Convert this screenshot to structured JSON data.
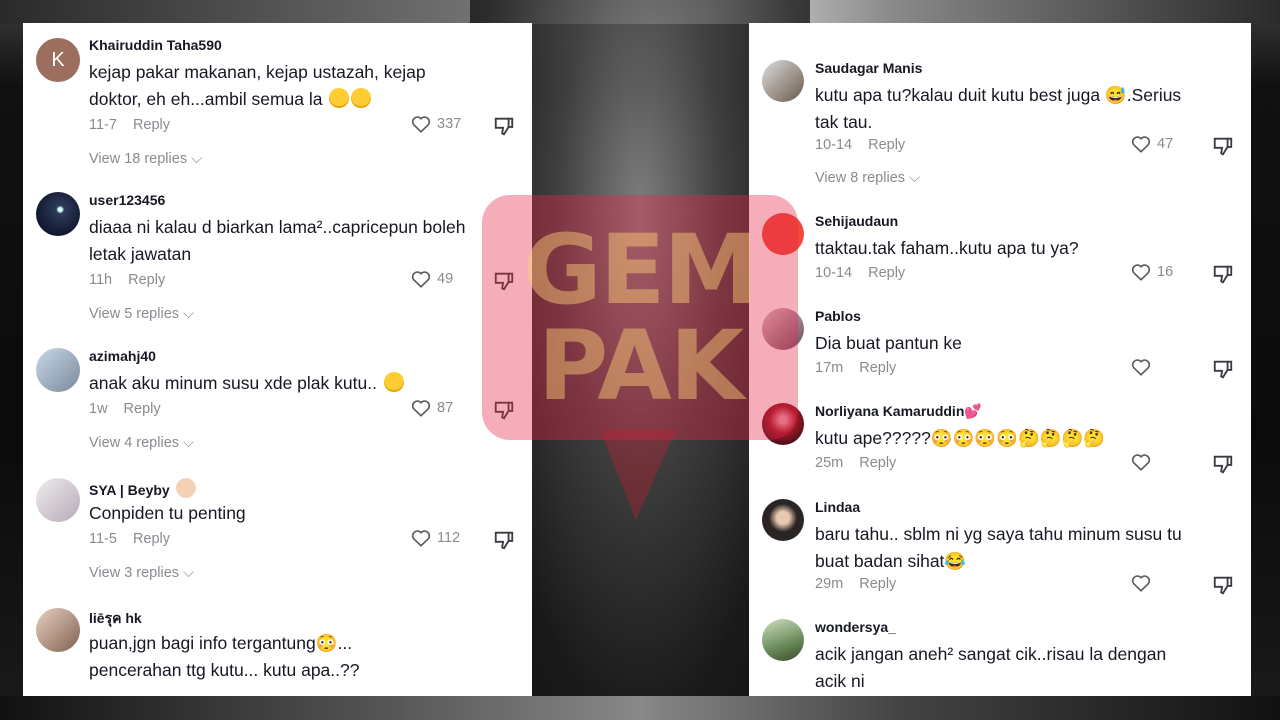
{
  "watermark": {
    "line1": "GEM",
    "line2": "PAK"
  },
  "left_comments": [
    {
      "user": "Khairuddin Taha590",
      "text": "kejap pakar makanan, kejap ustazah, kejap doktor, eh eh...ambil semua la",
      "emoji": "grin laugh",
      "date": "11-7",
      "reply": "Reply",
      "likes": "337",
      "replies": "View 18 replies",
      "avatar_letter": "K",
      "avatar_color": "#9b6e5e"
    },
    {
      "user": "user123456",
      "text": "diaaa ni kalau d biarkan lama²..capricepun boleh letak jawatan",
      "date": "11h",
      "reply": "Reply",
      "likes": "49",
      "replies": "View 5 replies",
      "avatar_color": "#2d3a5a"
    },
    {
      "user": "azimahj40",
      "text": "anak aku minum susu xde plak kutu..",
      "emoji": "smirk",
      "date": "1w",
      "reply": "Reply",
      "likes": "87",
      "replies": "View 4 replies",
      "avatar_color": "#a8b8c8"
    },
    {
      "user": "SYA | Beyby",
      "text": "Conpiden tu penting",
      "date": "11-5",
      "reply": "Reply",
      "likes": "112",
      "replies": "View 3 replies",
      "avatar_color": "#d9d2d8"
    },
    {
      "user": "liēรุค hk",
      "text": "puan,jgn bagi info tergantung😳... pencerahan ttg kutu... kutu apa..??",
      "avatar_color": "#c8a58a"
    }
  ],
  "right_comments": [
    {
      "user": "Saudagar Manis",
      "text": "kutu apa tu?kalau duit kutu best juga 😅.Serius tak tau.",
      "date": "10-14",
      "reply": "Reply",
      "likes": "47",
      "replies": "View 8 replies",
      "avatar_color": "#6a5a4a"
    },
    {
      "user": "Sehijaudaun",
      "text": "ttaktau.tak faham..kutu apa tu ya?",
      "date": "10-14",
      "reply": "Reply",
      "likes": "16",
      "avatar_color": "#f04a3a"
    },
    {
      "user": "Pablos",
      "text": "Dia buat pantun ke",
      "date": "17m",
      "reply": "Reply",
      "likes": "",
      "avatar_color": "#9a7a8a"
    },
    {
      "user": "Norliyana Kamaruddin💕",
      "text": "kutu ape?????😳😳😳😳🤔🤔🤔🤔",
      "date": "25m",
      "reply": "Reply",
      "likes": "",
      "avatar_color": "#a01828"
    },
    {
      "user": "Lindaa",
      "text": "baru tahu.. sblm ni yg saya tahu minum susu tu buat badan sihat😂",
      "date": "29m",
      "reply": "Reply",
      "likes": "",
      "avatar_color": "#2a2424"
    },
    {
      "user": "wondersya_",
      "text": "acik jangan aneh² sangat cik..risau la dengan acik ni",
      "avatar_color": "#6a8a5a"
    }
  ]
}
